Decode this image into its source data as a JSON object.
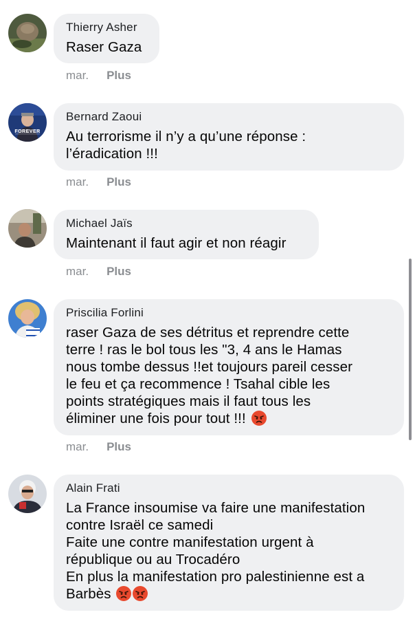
{
  "comments": [
    {
      "author": "Thierry Asher",
      "text": "Raser Gaza",
      "time": "mar.",
      "more": "Plus",
      "avatar_icon": "profile-photo"
    },
    {
      "author": "Bernard Zaoui",
      "text": "Au terrorisme il n’y a qu’une réponse :\nl’éradication !!!",
      "time": "mar.",
      "more": "Plus",
      "avatar_icon": "profile-photo",
      "avatar_badge": "FOREVER"
    },
    {
      "author": "Michael Jaïs",
      "text": "Maintenant il faut agir et non réagir",
      "time": "mar.",
      "more": "Plus",
      "avatar_icon": "profile-photo"
    },
    {
      "author": "Priscilia Forlini",
      "text": "raser Gaza de ses détritus et reprendre cette\nterre ! ras le bol tous les \"3, 4 ans le Hamas\nnous tombe dessus !!et toujours pareil cesser\nle feu et ça recommence ! Tsahal cible les\npoints stratégiques mais il faut tous les\néliminer une fois pour tout !!!",
      "time": "mar.",
      "more": "Plus",
      "avatar_icon": "profile-photo",
      "emoji": "angry-face-icon"
    },
    {
      "author": "Alain Frati",
      "text": "La France insoumise va faire une manifestation\ncontre Israël ce samedi\nFaite une contre manifestation urgent à\nrépublique ou au Trocadéro\nEn plus la manifestation pro palestinienne est a\nBarbès",
      "avatar_icon": "profile-photo",
      "emoji": "angry-face-icon"
    }
  ],
  "colors": {
    "bubble": "#eff0f2",
    "meta_text": "#8a8d91",
    "angry_emoji": "#e8492e"
  }
}
